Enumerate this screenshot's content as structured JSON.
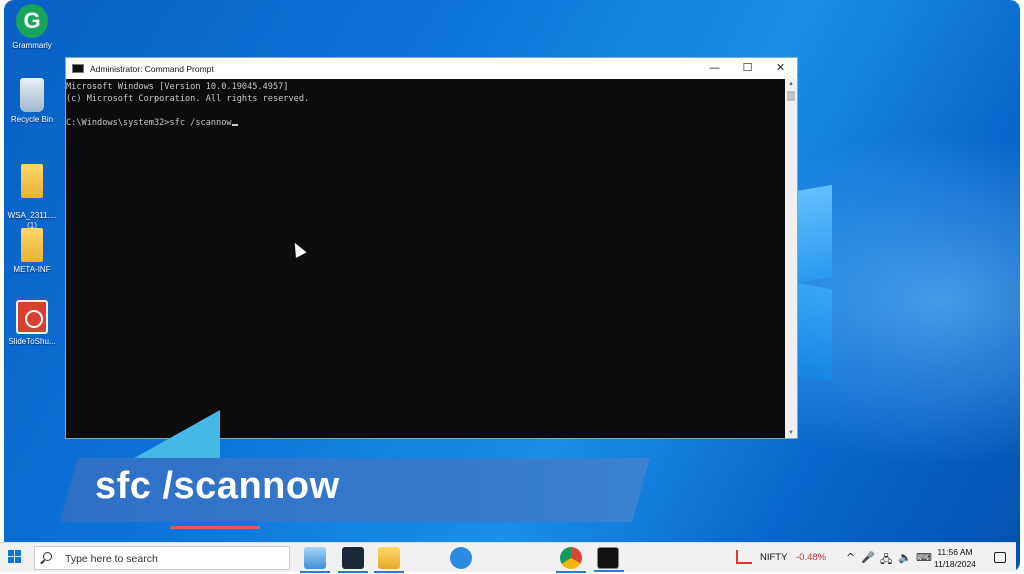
{
  "desktop": {
    "icons": [
      {
        "label": "Grammarly",
        "glyph": "G"
      },
      {
        "label": "Recycle Bin"
      },
      {
        "label": "WSA_2311....\n(1)"
      },
      {
        "label": "META-INF"
      },
      {
        "label": "SlideToShu..."
      }
    ]
  },
  "cmd_window": {
    "title": "Administrator: Command Prompt",
    "controls": {
      "minimize": "—",
      "maximize": "☐",
      "close": "✕"
    },
    "lines": [
      "Microsoft Windows [Version 10.0.19045.4957]",
      "(c) Microsoft Corporation. All rights reserved.",
      "",
      "C:\\Windows\\system32>sfc /scannow"
    ]
  },
  "banner": {
    "text": "sfc /scannow"
  },
  "taskbar": {
    "search_placeholder": "Type here to search",
    "nifty_label": "NIFTY",
    "nifty_change": "-0.48%",
    "time": "11:56 AM",
    "date": "11/18/2024",
    "tray": {
      "chevron": "^",
      "mic": "🎤",
      "network": "🖧",
      "volume": "🔈",
      "keyboard": "⌨"
    }
  },
  "colors": {
    "desktop_bg": "#0d74d8",
    "console_bg": "#0c0c0c",
    "banner_bg": "#3b82d0",
    "nifty_change": "#d32f2f"
  }
}
